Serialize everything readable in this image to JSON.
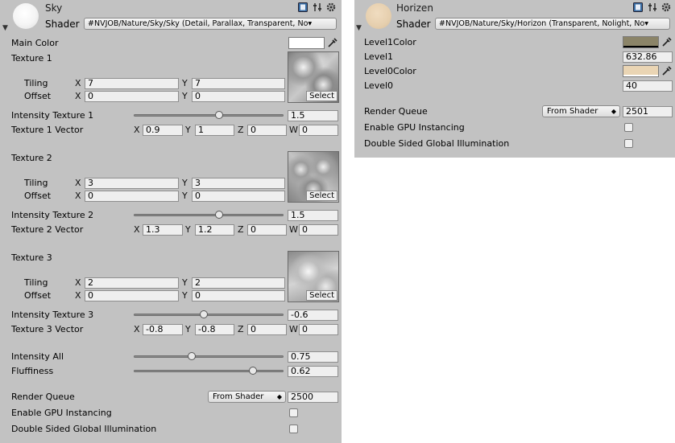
{
  "left": {
    "title": "Sky",
    "shader_label": "Shader",
    "shader_value": "#NVJOB/Nature/Sky/Sky (Detail, Parallax, Transparent, No▾",
    "main_color_label": "Main Color",
    "main_color": "#ffffff",
    "textures": [
      {
        "label": "Texture 1",
        "tiling_label": "Tiling",
        "offset_label": "Offset",
        "tiling_x": "7",
        "tiling_y": "7",
        "offset_x": "0",
        "offset_y": "0",
        "select": "Select"
      },
      {
        "label": "Texture 2",
        "tiling_label": "Tiling",
        "offset_label": "Offset",
        "tiling_x": "3",
        "tiling_y": "3",
        "offset_x": "0",
        "offset_y": "0",
        "select": "Select"
      },
      {
        "label": "Texture 3",
        "tiling_label": "Tiling",
        "offset_label": "Offset",
        "tiling_x": "2",
        "tiling_y": "2",
        "offset_x": "0",
        "offset_y": "0",
        "select": "Select"
      }
    ],
    "intensities": [
      {
        "label": "Intensity Texture 1",
        "value": "1.5",
        "fraction": 0.55
      },
      {
        "label": "Intensity Texture 2",
        "value": "1.5",
        "fraction": 0.55
      },
      {
        "label": "Intensity Texture 3",
        "value": "-0.6",
        "fraction": 0.45
      }
    ],
    "vectors": [
      {
        "label": "Texture 1 Vector",
        "x": "0.9",
        "y": "1",
        "z": "0",
        "w": "0"
      },
      {
        "label": "Texture 2 Vector",
        "x": "1.3",
        "y": "1.2",
        "z": "0",
        "w": "0"
      },
      {
        "label": "Texture 3 Vector",
        "x": "-0.8",
        "y": "-0.8",
        "z": "0",
        "w": "0"
      }
    ],
    "intensity_all": {
      "label": "Intensity All",
      "value": "0.75",
      "fraction": 0.375
    },
    "fluffiness": {
      "label": "Fluffiness",
      "value": "0.62",
      "fraction": 0.77
    },
    "render_queue": {
      "label": "Render Queue",
      "dropdown": "From Shader",
      "value": "2500"
    },
    "gpu_instancing": {
      "label": "Enable GPU Instancing"
    },
    "double_sided_gi": {
      "label": "Double Sided Global Illumination"
    }
  },
  "right": {
    "title": "Horizen",
    "shader_label": "Shader",
    "shader_value": "#NVJOB/Nature/Sky/Horizon (Transparent, Nolight, No▾",
    "level1color_label": "Level1Color",
    "level1color": "#8b8468",
    "level1_label": "Level1",
    "level1_value": "632.86",
    "level0color_label": "Level0Color",
    "level0color": "#ead5b4",
    "level0_label": "Level0",
    "level0_value": "40",
    "render_queue": {
      "label": "Render Queue",
      "dropdown": "From Shader",
      "value": "2501"
    },
    "gpu_instancing": {
      "label": "Enable GPU Instancing"
    },
    "double_sided_gi": {
      "label": "Double Sided Global Illumination"
    }
  },
  "axes": {
    "x": "X",
    "y": "Y",
    "z": "Z",
    "w": "W"
  },
  "icons": [
    "book-icon",
    "settings-sliders-icon",
    "gear-icon",
    "eyedropper-icon",
    "foldout-arrow-icon"
  ],
  "colors": {
    "panel": "#c2c2c2",
    "field": "#efefef"
  }
}
